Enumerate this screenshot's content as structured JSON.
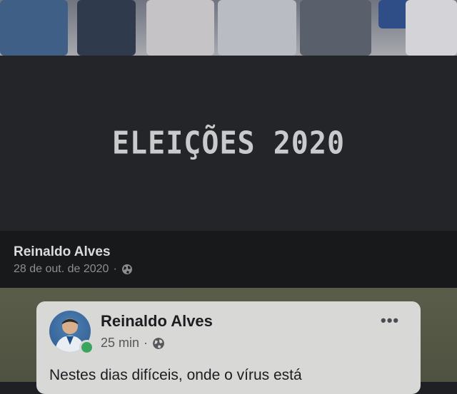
{
  "banner": {
    "title": "ELEIÇÕES 2020"
  },
  "post_meta": {
    "author": "Reinaldo Alves",
    "date": "28 de out. de 2020",
    "separator": "·",
    "privacy_icon": "globe-icon"
  },
  "embedded_post": {
    "author": "Reinaldo Alves",
    "time": "25 min",
    "separator": "·",
    "privacy_icon": "globe-icon",
    "more_icon": "more-options-icon",
    "more_label": "•••",
    "text": "Nestes dias difíceis, onde o vírus está",
    "status": "online"
  },
  "colors": {
    "banner_bg": "#232528",
    "banner_text": "#c9cacc",
    "meta_bg": "#18191b",
    "card_bg": "#d8d8d6",
    "online": "#3ba55d"
  }
}
